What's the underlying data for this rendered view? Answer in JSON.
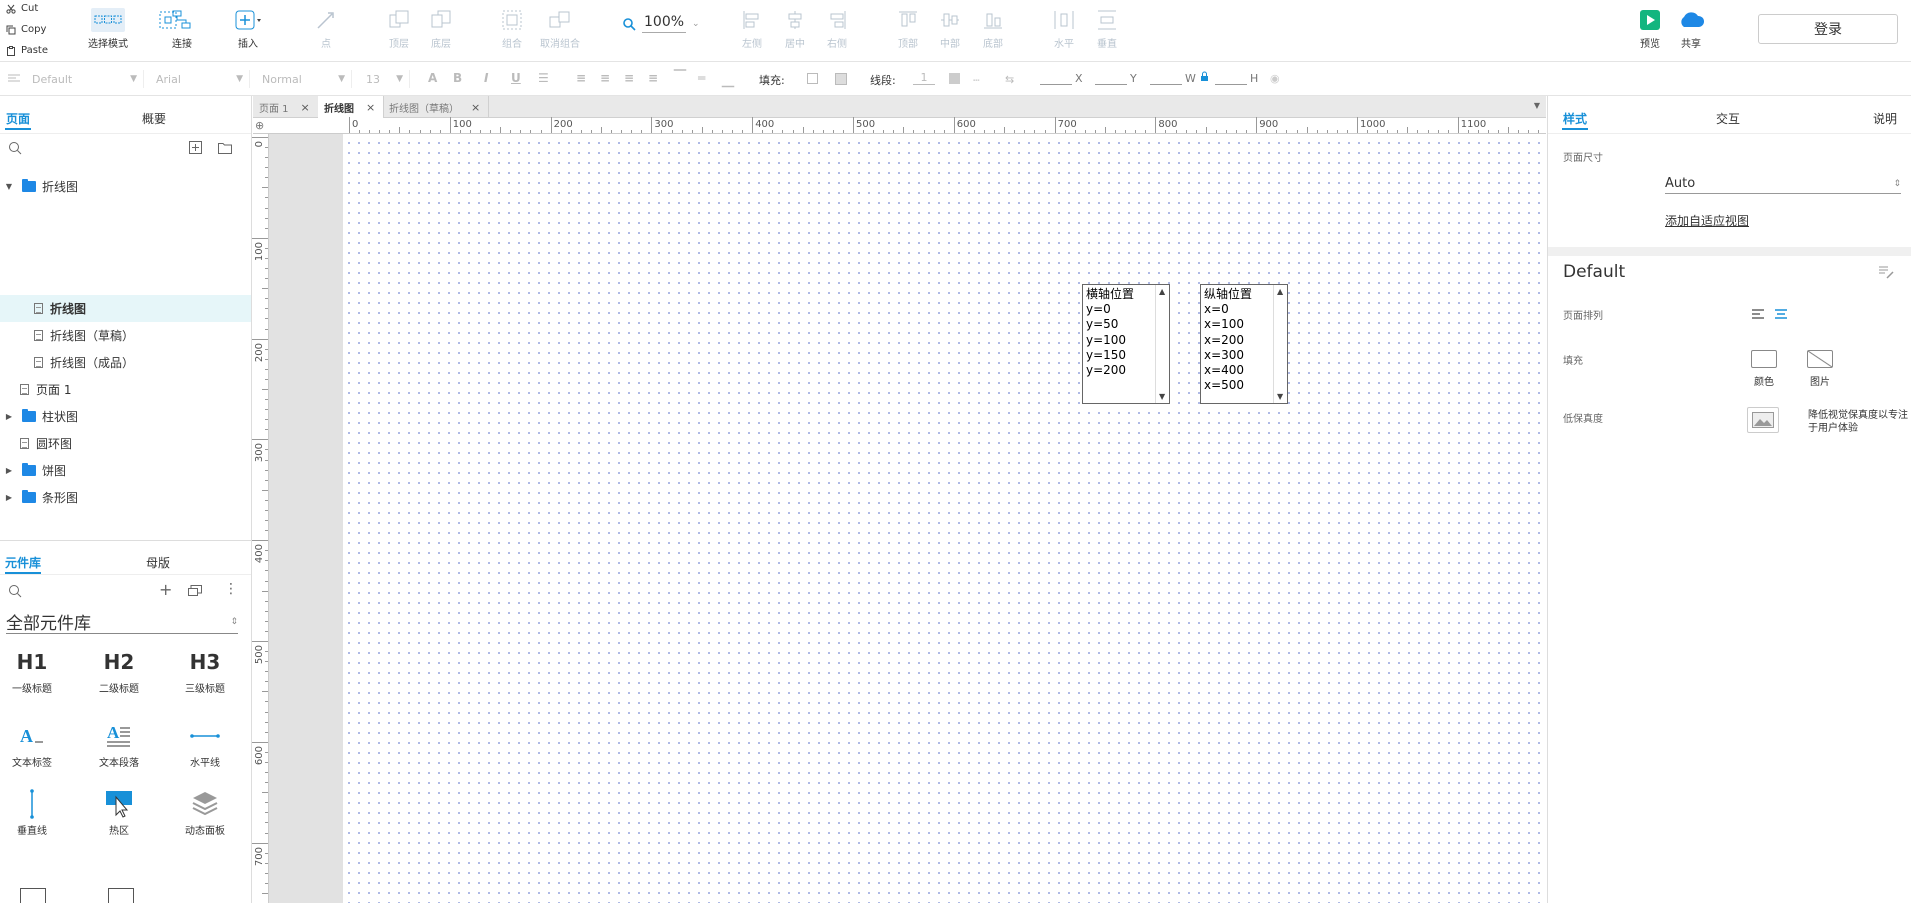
{
  "clipboard": {
    "cut": "Cut",
    "copy": "Copy",
    "paste": "Paste"
  },
  "toolbar": {
    "select_mode": "选择模式",
    "connect": "连接",
    "insert": "插入",
    "point": "点",
    "top_layer": "顶层",
    "bottom_layer": "底层",
    "group": "组合",
    "ungroup": "取消组合",
    "zoom": "100%",
    "align_left": "左侧",
    "align_center": "居中",
    "align_right": "右侧",
    "align_top": "顶部",
    "align_middle": "中部",
    "align_bottom": "底部",
    "distribute_h": "水平",
    "distribute_v": "垂直",
    "preview": "预览",
    "share": "共享",
    "login": "登录",
    "accent_color": "#1890d8",
    "preview_color": "#13b57f",
    "share_color": "#1e88e5"
  },
  "formatbar": {
    "style": "Default",
    "font": "Arial",
    "weight": "Normal",
    "size": "13",
    "fill_label": "填充:",
    "stroke_label": "线段:",
    "stroke_value": "1",
    "x": "X",
    "y": "Y",
    "w": "W",
    "h": "H"
  },
  "left_panel": {
    "tabs": [
      "页面",
      "概要"
    ],
    "tree": [
      {
        "label": "折线图",
        "type": "folder",
        "expanded": true
      },
      {
        "label": "折线图",
        "type": "page",
        "selected": true
      },
      {
        "label": "折线图（草稿）",
        "type": "page"
      },
      {
        "label": "折线图（成品）",
        "type": "page"
      },
      {
        "label": "页面 1",
        "type": "page"
      },
      {
        "label": "柱状图",
        "type": "folder",
        "expanded": false
      },
      {
        "label": "圆环图",
        "type": "page"
      },
      {
        "label": "饼图",
        "type": "folder",
        "expanded": false
      },
      {
        "label": "条形图",
        "type": "folder",
        "expanded": false
      }
    ],
    "lib_tabs": [
      "元件库",
      "母版"
    ],
    "library_name": "全部元件库",
    "widgets": [
      {
        "icon": "H1",
        "label": "一级标题"
      },
      {
        "icon": "H2",
        "label": "二级标题"
      },
      {
        "icon": "H3",
        "label": "三级标题"
      },
      {
        "icon": "A_",
        "label": "文本标签"
      },
      {
        "icon": "A≡",
        "label": "文本段落"
      },
      {
        "icon": "—",
        "label": "水平线"
      },
      {
        "icon": "|",
        "label": "垂直线"
      },
      {
        "icon": "hotspot",
        "label": "热区"
      },
      {
        "icon": "layers",
        "label": "动态面板"
      }
    ]
  },
  "canvas": {
    "tabs": [
      "页面 1",
      "折线图",
      "折线图（草稿）"
    ],
    "active_tab": 1,
    "ruler_h": [
      "0",
      "100",
      "200",
      "300",
      "400",
      "500",
      "600",
      "700",
      "800",
      "900",
      "1000",
      "1100"
    ],
    "ruler_v": [
      "0",
      "100",
      "200",
      "300",
      "400",
      "500",
      "600",
      "700"
    ],
    "listbox_x": {
      "items": [
        "横轴位置",
        "y=0",
        "y=50",
        "y=100",
        "y=150",
        "y=200"
      ]
    },
    "listbox_y": {
      "items": [
        "纵轴位置",
        "x=0",
        "x=100",
        "x=200",
        "x=300",
        "x=400",
        "x=500"
      ]
    }
  },
  "right_panel": {
    "tabs": [
      "样式",
      "交互",
      "说明"
    ],
    "page_size_label": "页面尺寸",
    "page_size_value": "Auto",
    "add_adaptive": "添加自适应视图",
    "style_name": "Default",
    "page_align_label": "页面排列",
    "fill_label": "填充",
    "fill_color": "颜色",
    "fill_image": "图片",
    "low_fidelity_label": "低保真度",
    "low_fidelity_desc": "降低视觉保真度以专注于用户体验"
  }
}
